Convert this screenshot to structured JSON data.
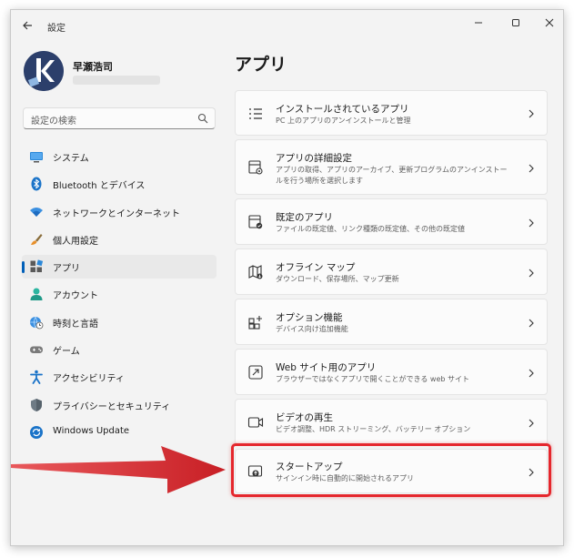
{
  "window": {
    "title": "設定"
  },
  "profile": {
    "name": "早瀬浩司"
  },
  "search": {
    "placeholder": "設定の検索"
  },
  "sidebar": {
    "items": [
      {
        "label": "システム",
        "icon": "display-icon"
      },
      {
        "label": "Bluetooth とデバイス",
        "icon": "bluetooth-icon"
      },
      {
        "label": "ネットワークとインターネット",
        "icon": "wifi-icon"
      },
      {
        "label": "個人用設定",
        "icon": "brush-icon"
      },
      {
        "label": "アプリ",
        "icon": "apps-icon",
        "active": true
      },
      {
        "label": "アカウント",
        "icon": "person-icon"
      },
      {
        "label": "時刻と言語",
        "icon": "globe-clock-icon"
      },
      {
        "label": "ゲーム",
        "icon": "gamepad-icon"
      },
      {
        "label": "アクセシビリティ",
        "icon": "accessibility-icon"
      },
      {
        "label": "プライバシーとセキュリティ",
        "icon": "shield-icon"
      },
      {
        "label": "Windows Update",
        "icon": "update-icon"
      }
    ]
  },
  "main": {
    "title": "アプリ",
    "cards": [
      {
        "title": "インストールされているアプリ",
        "desc": "PC 上のアプリのアンインストールと管理",
        "icon": "list-icon"
      },
      {
        "title": "アプリの詳細設定",
        "desc": "アプリの取得、アプリのアーカイブ、更新プログラムのアンインストールを行う場所を選択します",
        "icon": "app-settings-icon"
      },
      {
        "title": "既定のアプリ",
        "desc": "ファイルの既定値、リンク種類の既定値、その他の既定値",
        "icon": "default-apps-icon"
      },
      {
        "title": "オフライン マップ",
        "desc": "ダウンロード、保存場所、マップ更新",
        "icon": "map-icon"
      },
      {
        "title": "オプション機能",
        "desc": "デバイス向け追加機能",
        "icon": "optional-features-icon"
      },
      {
        "title": "Web サイト用のアプリ",
        "desc": "ブラウザーではなくアプリで開くことができる web サイト",
        "icon": "web-apps-icon"
      },
      {
        "title": "ビデオの再生",
        "desc": "ビデオ調整、HDR ストリーミング、バッテリー オプション",
        "icon": "video-icon"
      },
      {
        "title": "スタートアップ",
        "desc": "サインイン時に自動的に開始されるアプリ",
        "icon": "startup-icon"
      }
    ]
  },
  "colors": {
    "accent": "#005fb8",
    "highlight": "#e5272d",
    "arrow": "#d32328"
  }
}
